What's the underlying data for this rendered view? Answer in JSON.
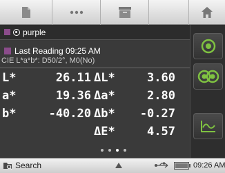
{
  "toolbar": {
    "buttons": [
      {
        "icon": "document-icon"
      },
      {
        "icon": "more-icon"
      },
      {
        "icon": "archive-icon"
      },
      {
        "icon": "blank"
      },
      {
        "icon": "home-icon"
      }
    ]
  },
  "sample": {
    "name": "purple",
    "swatch_color": "#8b4c8b"
  },
  "reading": {
    "title": "Last Reading 09:25 AM",
    "conditions": "CIE L*a*b*: D50/2°, M0(No)"
  },
  "measurements": [
    {
      "label": "L*",
      "value": "26.11",
      "delta_label": "ΔL*",
      "delta_value": "3.60"
    },
    {
      "label": "a*",
      "value": "19.36",
      "delta_label": "Δa*",
      "delta_value": "2.80"
    },
    {
      "label": "b*",
      "value": "-40.20",
      "delta_label": "Δb*",
      "delta_value": "-0.27"
    },
    {
      "label": "",
      "value": "",
      "delta_label": "ΔE*",
      "delta_value": "4.57"
    }
  ],
  "pager": {
    "pages": 4,
    "current": 3
  },
  "side_buttons": [
    {
      "icon": "target-icon"
    },
    {
      "icon": "compare-icon"
    },
    {
      "icon": "spectral-curve-icon"
    }
  ],
  "status": {
    "search_label": "Search",
    "time": "09:26 AM"
  },
  "colors": {
    "accent_green": "#7fc241",
    "swatch": "#8b4c8b"
  }
}
